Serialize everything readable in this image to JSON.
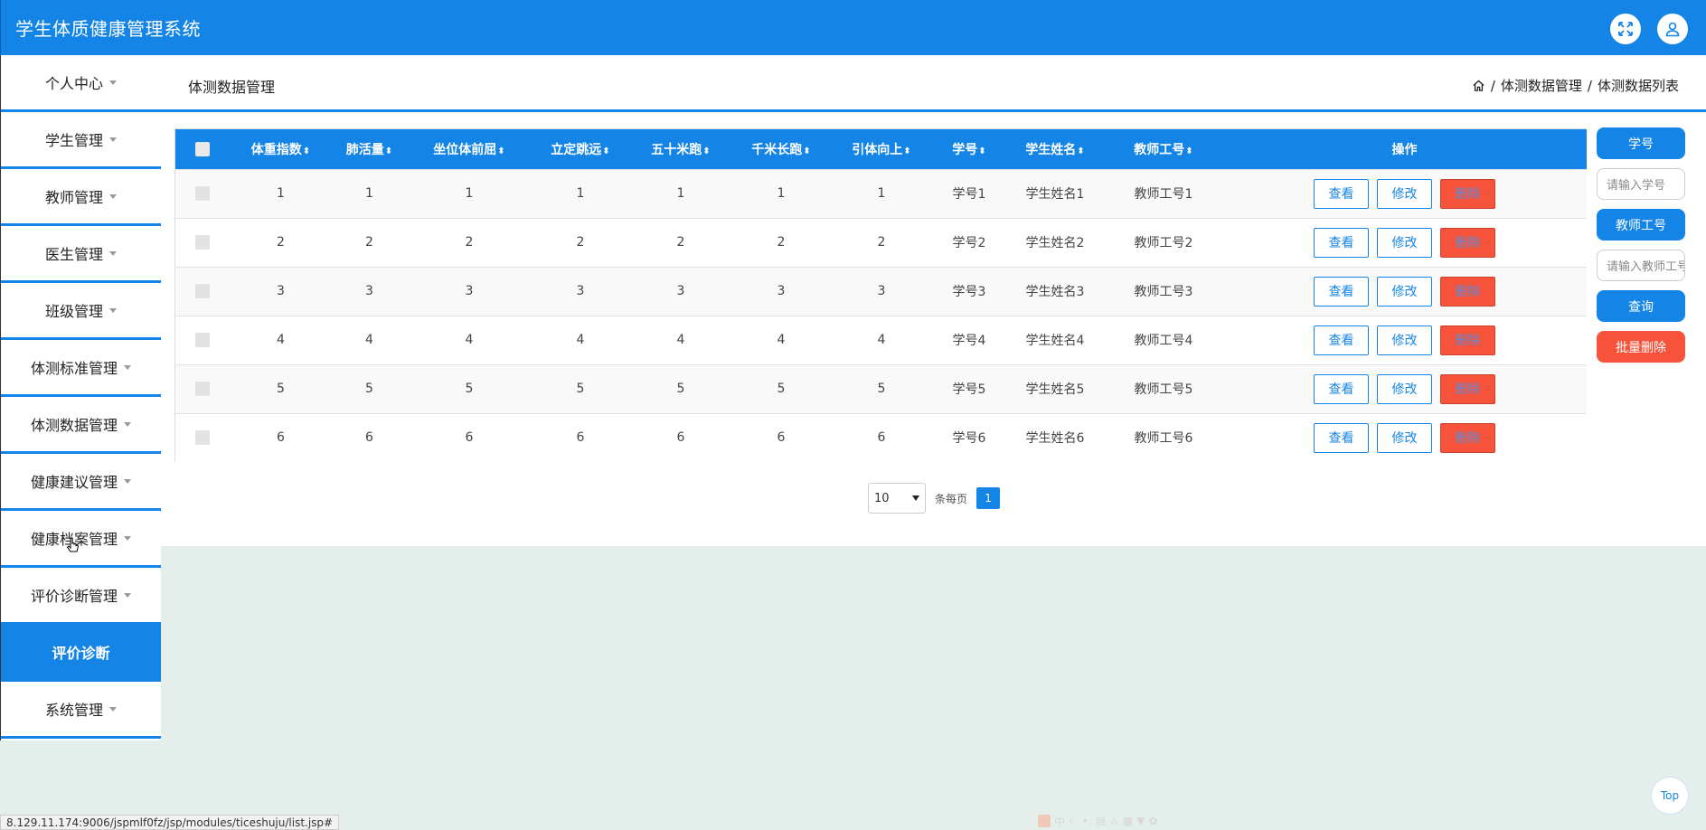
{
  "header": {
    "title": "学生体质健康管理系统"
  },
  "sidebar": {
    "items": [
      {
        "label": "个人中心",
        "caret": true,
        "active": false
      },
      {
        "label": "学生管理",
        "caret": true,
        "active": false
      },
      {
        "label": "教师管理",
        "caret": true,
        "active": false
      },
      {
        "label": "医生管理",
        "caret": true,
        "active": false
      },
      {
        "label": "班级管理",
        "caret": true,
        "active": false
      },
      {
        "label": "体测标准管理",
        "caret": true,
        "active": false
      },
      {
        "label": "体测数据管理",
        "caret": true,
        "active": false
      },
      {
        "label": "健康建议管理",
        "caret": true,
        "active": false
      },
      {
        "label": "健康档案管理",
        "caret": true,
        "active": false
      },
      {
        "label": "评价诊断管理",
        "caret": true,
        "active": false
      },
      {
        "label": "评价诊断",
        "caret": false,
        "active": true
      },
      {
        "label": "系统管理",
        "caret": true,
        "active": false
      }
    ]
  },
  "topbar": {
    "page_title": "体测数据管理",
    "breadcrumb": [
      "体测数据管理",
      "体测数据列表"
    ],
    "separator": "/"
  },
  "table": {
    "sort_glyph": "⬍",
    "columns": [
      "体重指数",
      "肺活量",
      "坐位体前屈",
      "立定跳远",
      "五十米跑",
      "千米长跑",
      "引体向上",
      "学号",
      "学生姓名",
      "教师工号"
    ],
    "ops_header": "操作",
    "rows": [
      [
        "1",
        "1",
        "1",
        "1",
        "1",
        "1",
        "1",
        "学号1",
        "学生姓名1",
        "教师工号1"
      ],
      [
        "2",
        "2",
        "2",
        "2",
        "2",
        "2",
        "2",
        "学号2",
        "学生姓名2",
        "教师工号2"
      ],
      [
        "3",
        "3",
        "3",
        "3",
        "3",
        "3",
        "3",
        "学号3",
        "学生姓名3",
        "教师工号3"
      ],
      [
        "4",
        "4",
        "4",
        "4",
        "4",
        "4",
        "4",
        "学号4",
        "学生姓名4",
        "教师工号4"
      ],
      [
        "5",
        "5",
        "5",
        "5",
        "5",
        "5",
        "5",
        "学号5",
        "学生姓名5",
        "教师工号5"
      ],
      [
        "6",
        "6",
        "6",
        "6",
        "6",
        "6",
        "6",
        "学号6",
        "学生姓名6",
        "教师工号6"
      ]
    ],
    "actions": {
      "view": "查看",
      "edit": "修改",
      "delete": "删除"
    }
  },
  "pagination": {
    "page_size": "10",
    "per_page_label": "条每页",
    "current_page": "1"
  },
  "search": {
    "student_label": "学号",
    "student_placeholder": "请输入学号",
    "teacher_label": "教师工号",
    "teacher_placeholder": "请输入教师工号",
    "query_button": "查询",
    "batch_delete_button": "批量删除"
  },
  "top_button": "Top",
  "status_url": "8.129.11.174:9006/jspmlf0fz/jsp/modules/ticeshuju/list.jsp#",
  "ime_char": "中",
  "colors": {
    "primary": "#1485e6",
    "danger": "#f7533a",
    "background": "#e4efec"
  }
}
